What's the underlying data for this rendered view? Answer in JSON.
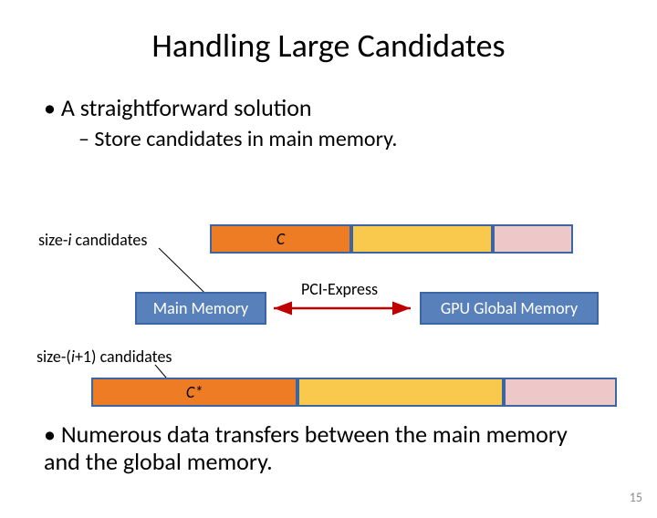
{
  "title": "Handling Large Candidates",
  "bullets": {
    "b1": "A straightforward solution",
    "b2": "Store candidates in main memory."
  },
  "labels": {
    "sizei_pre": "size-",
    "sizei_var": "i",
    "sizei_post": " candidates",
    "sizei1_pre": "size-(",
    "sizei1_var": "i",
    "sizei1_post": "+1) candidates",
    "C": "C",
    "Cstar": "C*",
    "main_memory": "Main Memory",
    "gpu_memory": "GPU Global Memory",
    "pci": "PCI-Express"
  },
  "bottom": "Numerous data transfers between the main memory and the global memory.",
  "page": "15"
}
